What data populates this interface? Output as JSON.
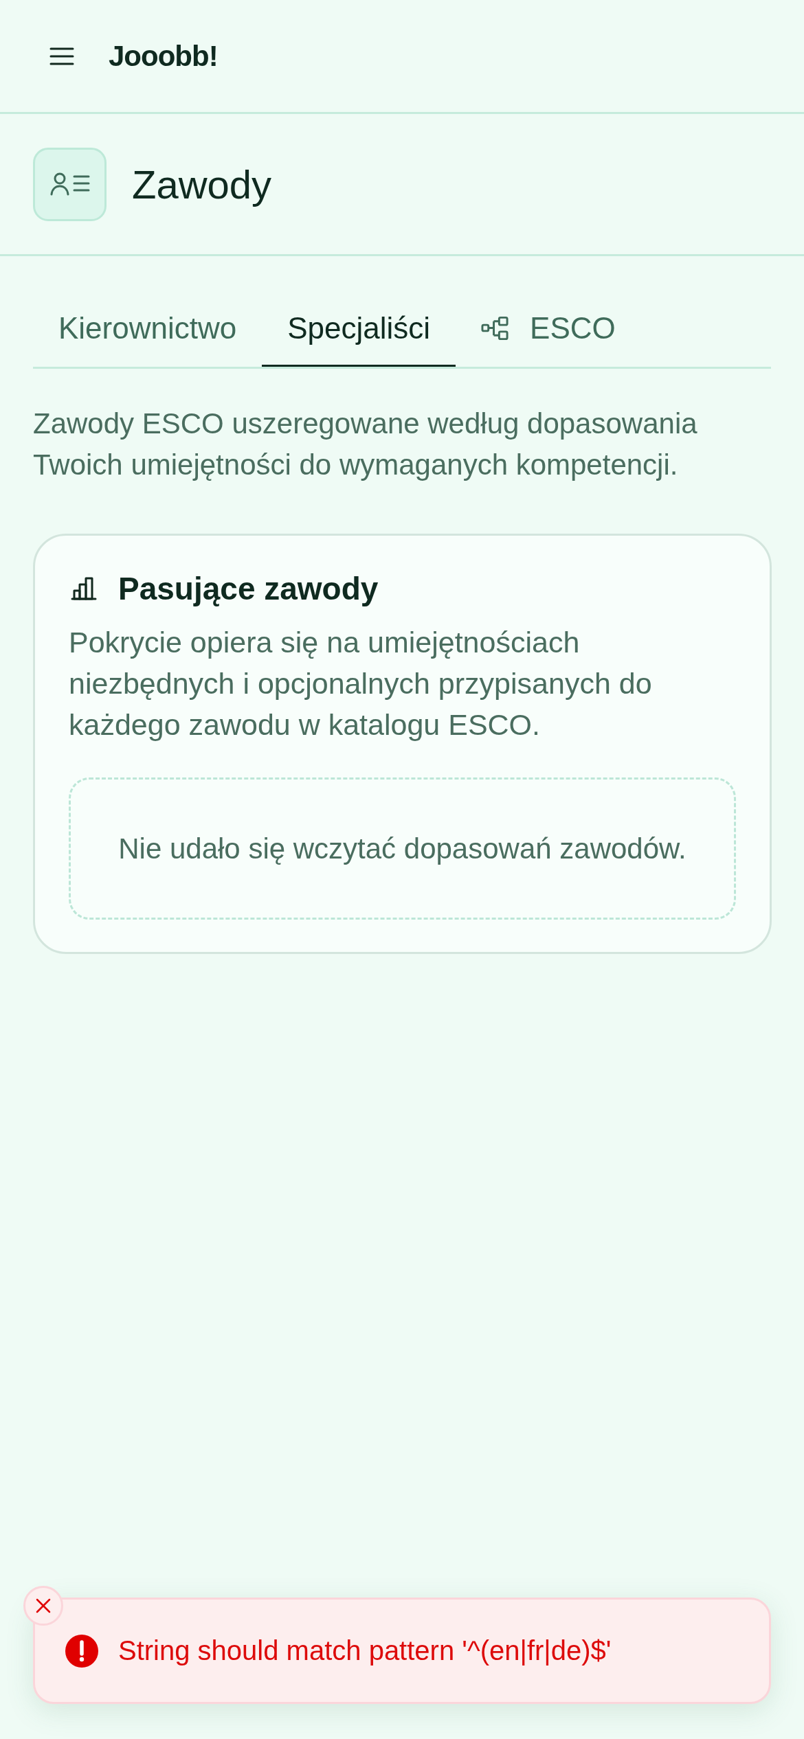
{
  "header": {
    "logo": "Jooobb!"
  },
  "page": {
    "title": "Zawody"
  },
  "tabs": [
    {
      "label": "Kierownictwo",
      "selected": false,
      "kind": "plain"
    },
    {
      "label": "Specjaliści",
      "selected": true,
      "kind": "plain"
    },
    {
      "label": "ESCO",
      "selected": false,
      "kind": "icon"
    }
  ],
  "description": "Zawody ESCO uszeregowane według dopasowania Twoich umiejętności do wymaganych kompetencji.",
  "card": {
    "title": "Pasujące zawody",
    "description": "Pokrycie opiera się na umiejętnościach niezbędnych i opcjonalnych przypisanych do każdego zawodu w katalogu ESCO.",
    "empty_message": "Nie udało się wczytać dopasowań zawodów."
  },
  "toast": {
    "kind": "error",
    "message": "String should match pattern '^(en|fr|de)$'"
  }
}
